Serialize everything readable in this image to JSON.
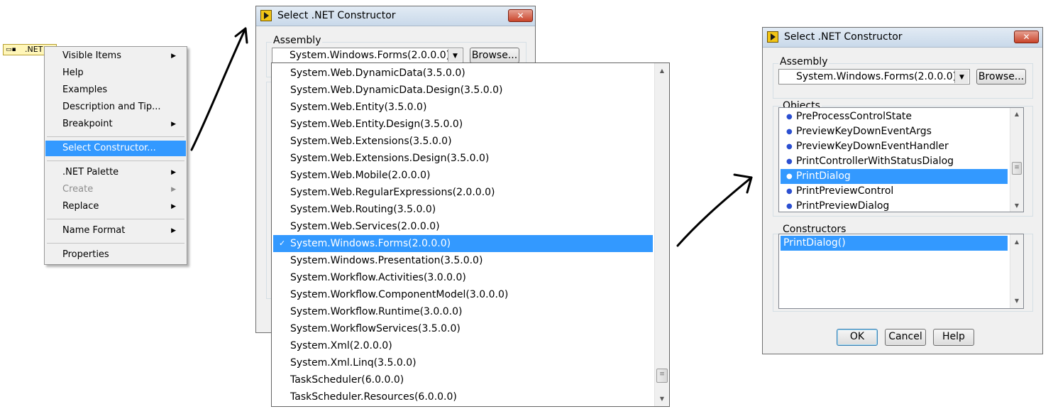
{
  "refnum": {
    "label": ".NET"
  },
  "context_menu": {
    "items": [
      {
        "label": "Visible Items",
        "submenu": true
      },
      {
        "label": "Help"
      },
      {
        "label": "Examples"
      },
      {
        "label": "Description and Tip..."
      },
      {
        "label": "Breakpoint",
        "submenu": true
      },
      {
        "label": "Select Constructor...",
        "selected": true
      },
      {
        "label": ".NET Palette",
        "submenu": true
      },
      {
        "label": "Create",
        "submenu": true,
        "disabled": true
      },
      {
        "label": "Replace",
        "submenu": true
      },
      {
        "label": "Name Format",
        "submenu": true
      },
      {
        "label": "Properties"
      }
    ]
  },
  "dialog_left": {
    "title": "Select .NET Constructor",
    "close_label": "✕",
    "assembly_label": "Assembly",
    "assembly_value": "System.Windows.Forms(2.0.0.0)",
    "browse_label": "Browse..."
  },
  "dropdown": {
    "items": [
      "System.Web.DynamicData(3.5.0.0)",
      "System.Web.DynamicData.Design(3.5.0.0)",
      "System.Web.Entity(3.5.0.0)",
      "System.Web.Entity.Design(3.5.0.0)",
      "System.Web.Extensions(3.5.0.0)",
      "System.Web.Extensions.Design(3.5.0.0)",
      "System.Web.Mobile(2.0.0.0)",
      "System.Web.RegularExpressions(2.0.0.0)",
      "System.Web.Routing(3.5.0.0)",
      "System.Web.Services(2.0.0.0)",
      "System.Windows.Forms(2.0.0.0)",
      "System.Windows.Presentation(3.5.0.0)",
      "System.Workflow.Activities(3.0.0.0)",
      "System.Workflow.ComponentModel(3.0.0.0)",
      "System.Workflow.Runtime(3.0.0.0)",
      "System.WorkflowServices(3.5.0.0)",
      "System.Xml(2.0.0.0)",
      "System.Xml.Linq(3.5.0.0)",
      "TaskScheduler(6.0.0.0)",
      "TaskScheduler.Resources(6.0.0.0)"
    ],
    "checked_item": "System.Windows.Forms(2.0.0.0)",
    "check_mark": "✓"
  },
  "dialog_right": {
    "title": "Select .NET Constructor",
    "close_label": "✕",
    "assembly_label": "Assembly",
    "assembly_value": "System.Windows.Forms(2.0.0.0)",
    "browse_label": "Browse...",
    "objects_label": "Objects",
    "objects": [
      "PreProcessControlState",
      "PreviewKeyDownEventArgs",
      "PreviewKeyDownEventHandler",
      "PrintControllerWithStatusDialog",
      "PrintDialog",
      "PrintPreviewControl",
      "PrintPreviewDialog"
    ],
    "selected_object": "PrintDialog",
    "constructors_label": "Constructors",
    "constructors": [
      "PrintDialog()"
    ],
    "ok_label": "OK",
    "cancel_label": "Cancel",
    "help_label": "Help"
  },
  "colors": {
    "selection": "#3399ff",
    "dialog_bg": "#f0f0f0",
    "refnum_bg": "#fff6b8"
  }
}
